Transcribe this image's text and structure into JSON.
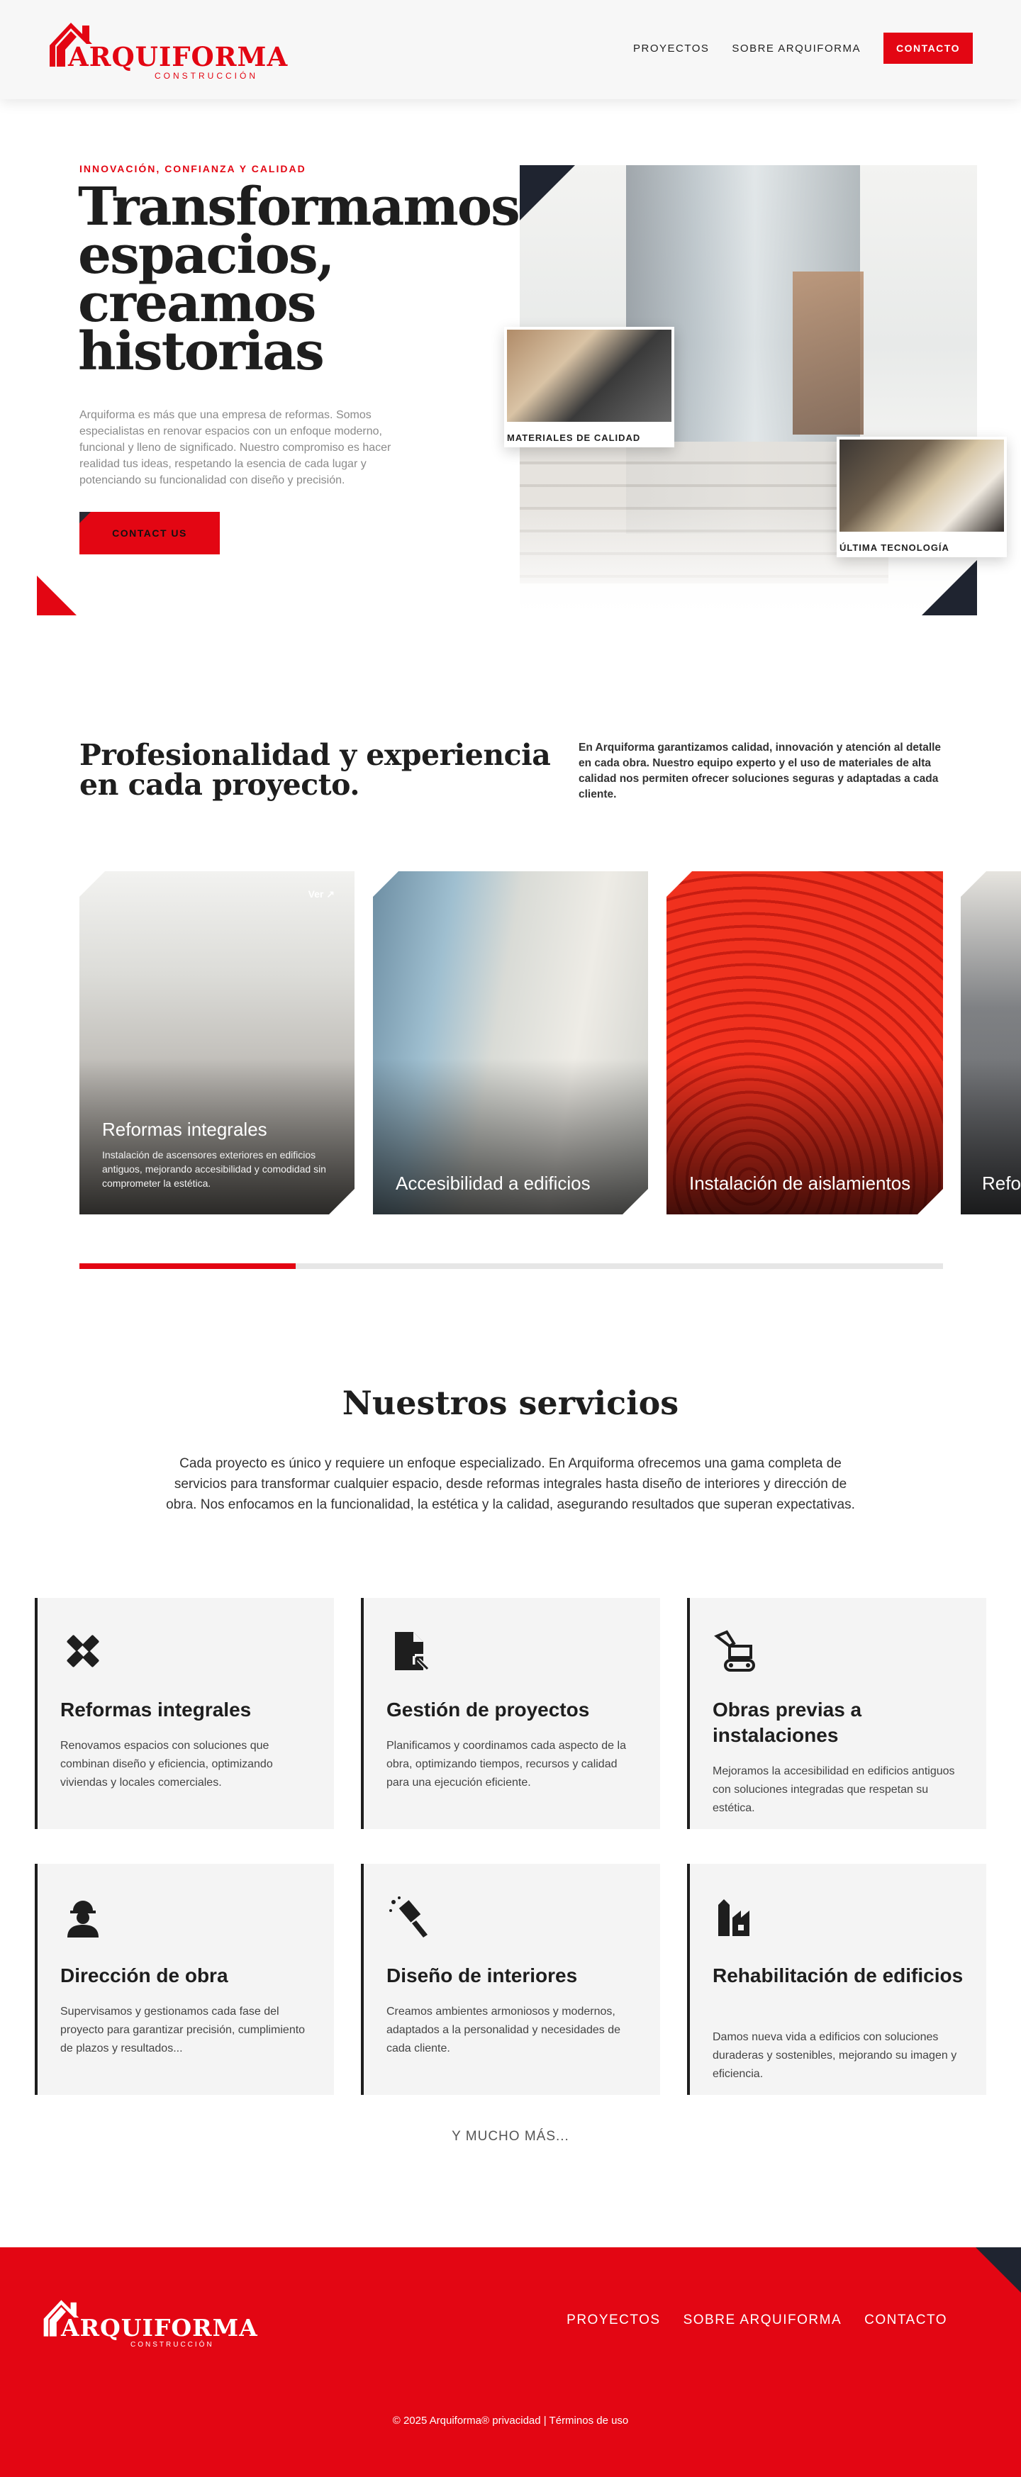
{
  "brand": {
    "name": "ARQUIFORMA",
    "tagline": "CONSTRUCCIÓN",
    "accent_color": "#e30613",
    "dark_color": "#1f2430"
  },
  "nav": {
    "items": [
      "PROYECTOS",
      "SOBRE ARQUIFORMA"
    ],
    "cta": "CONTACTO"
  },
  "hero": {
    "eyebrow": "INNOVACIÓN, CONFIANZA Y CALIDAD",
    "title": "Transformamos espacios, creamos historias",
    "description": "Arquiforma es más que una empresa de reformas. Somos especialistas en renovar espacios con un enfoque moderno, funcional y lleno de significado. Nuestro compromiso es hacer realidad tus ideas, respetando la esencia de cada lugar y potenciando su funcionalidad con diseño y precisión.",
    "cta": "CONTACT US",
    "insets": [
      "MATERIALES DE CALIDAD",
      "ÚLTIMA TECNOLOGÍA"
    ]
  },
  "intro": {
    "title": "Profesionalidad y experiencia en cada proyecto.",
    "description": "En Arquiforma garantizamos calidad, innovación y atención al detalle en cada obra. Nuestro equipo experto y el uso de materiales de alta calidad nos permiten ofrecer soluciones seguras y adaptadas a cada cliente."
  },
  "projects": {
    "link_label": "Ver",
    "cards": [
      {
        "title": "Reformas integrales",
        "text": "Instalación de ascensores exteriores en edificios antiguos, mejorando accesibilidad y comodidad sin comprometer la estética."
      },
      {
        "title": "Accesibilidad a edificios"
      },
      {
        "title": "Instalación de aislamientos"
      },
      {
        "title": "Reformas"
      }
    ],
    "progress": 0.25
  },
  "services": {
    "title": "Nuestros servicios",
    "intro": "Cada proyecto es único y requiere un enfoque especializado. En Arquiforma ofrecemos una gama completa de servicios para transformar cualquier espacio, desde reformas integrales hasta diseño de interiores y dirección de obra. Nos enfocamos en la funcionalidad, la estética y la calidad, asegurando resultados que superan expectativas.",
    "items": [
      {
        "icon": "tools-icon",
        "title": "Reformas integrales",
        "text": "Renovamos espacios con soluciones que combinan diseño y eficiencia, optimizando viviendas y locales comerciales."
      },
      {
        "icon": "document-icon",
        "title": "Gestión de proyectos",
        "text": "Planificamos y coordinamos cada aspecto de la obra, optimizando tiempos, recursos y calidad para una ejecución eficiente."
      },
      {
        "icon": "excavator-icon",
        "title": "Obras previas a instalaciones",
        "text": "Mejoramos la accesibilidad en edificios antiguos con soluciones integradas que respetan su estética."
      },
      {
        "icon": "worker-icon",
        "title": "Dirección de obra",
        "text": "Supervisamos y gestionamos cada fase del proyecto para garantizar precisión, cumplimiento de plazos y resultados..."
      },
      {
        "icon": "paint-brush-icon",
        "title": "Diseño de interiores",
        "text": "Creamos ambientes armoniosos y modernos, adaptados a la personalidad y necesidades de cada cliente."
      },
      {
        "icon": "building-icon",
        "title": "Rehabilitación de edificios",
        "text": "Damos nueva vida a edificios con soluciones duraderas y sostenibles, mejorando su imagen y eficiencia."
      }
    ],
    "more": "Y MUCHO MÁS..."
  },
  "footer": {
    "nav": [
      "PROYECTOS",
      "SOBRE ARQUIFORMA",
      "CONTACTO"
    ],
    "copyright": "© 2025 Arquiforma® privacidad | Términos de uso"
  }
}
